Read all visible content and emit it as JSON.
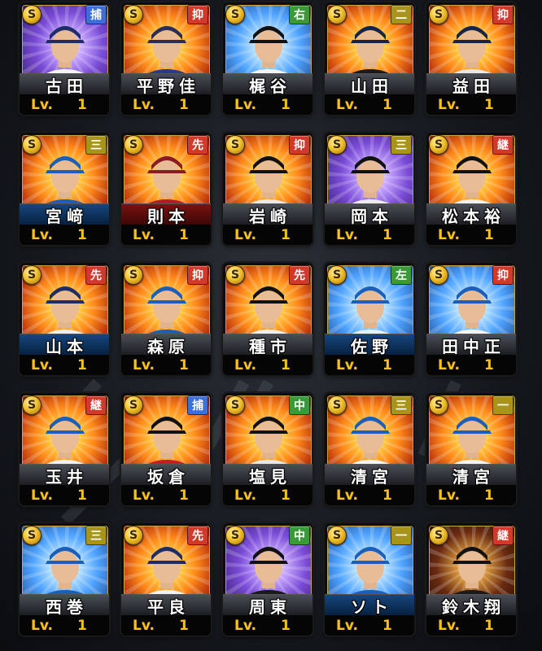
{
  "colors": {
    "catcher": "#2f6fd6",
    "pitcher_relief": "#d23a2a",
    "pitcher_start": "#d23a2a",
    "pitcher_setup": "#d23a2a",
    "infield": "#a9931b",
    "outfield": "#2f8a3a",
    "level_text": "#f6c21a"
  },
  "level_label": "Lv.",
  "rarity_symbol": "S",
  "cards": [
    {
      "name": "古田",
      "position": "捕",
      "pos_color": "#3e6ed8",
      "level": "1",
      "bg": "purple",
      "bar": "gray"
    },
    {
      "name": "平野佳",
      "position": "抑",
      "pos_color": "#cf3a2a",
      "level": "1",
      "bg": "warm",
      "bar": "gray"
    },
    {
      "name": "梶谷",
      "position": "右",
      "pos_color": "#3a9a3a",
      "level": "1",
      "bg": "cool",
      "bar": "gray"
    },
    {
      "name": "山田",
      "position": "二",
      "pos_color": "#a8931b",
      "level": "1",
      "bg": "warm",
      "bar": "gray"
    },
    {
      "name": "益田",
      "position": "抑",
      "pos_color": "#cf3a2a",
      "level": "1",
      "bg": "warm",
      "bar": "gray"
    },
    {
      "name": "宮﨑",
      "position": "三",
      "pos_color": "#a8931b",
      "level": "1",
      "bg": "warm",
      "bar": "blue"
    },
    {
      "name": "則本",
      "position": "先",
      "pos_color": "#cf3a2a",
      "level": "1",
      "bg": "warm",
      "bar": "red"
    },
    {
      "name": "岩崎",
      "position": "抑",
      "pos_color": "#cf3a2a",
      "level": "1",
      "bg": "warm",
      "bar": "gray"
    },
    {
      "name": "岡本",
      "position": "三",
      "pos_color": "#a8931b",
      "level": "1",
      "bg": "purple",
      "bar": "gray"
    },
    {
      "name": "松本裕",
      "position": "継",
      "pos_color": "#cf3a2a",
      "level": "1",
      "bg": "warm",
      "bar": "gray"
    },
    {
      "name": "山本",
      "position": "先",
      "pos_color": "#cf3a2a",
      "level": "1",
      "bg": "warm",
      "bar": "blue"
    },
    {
      "name": "森原",
      "position": "抑",
      "pos_color": "#cf3a2a",
      "level": "1",
      "bg": "warm",
      "bar": "gray"
    },
    {
      "name": "種市",
      "position": "先",
      "pos_color": "#cf3a2a",
      "level": "1",
      "bg": "warm",
      "bar": "gray"
    },
    {
      "name": "佐野",
      "position": "左",
      "pos_color": "#3a9a3a",
      "level": "1",
      "bg": "cool",
      "bar": "blue"
    },
    {
      "name": "田中正",
      "position": "抑",
      "pos_color": "#cf3a2a",
      "level": "1",
      "bg": "cool",
      "bar": "gray"
    },
    {
      "name": "玉井",
      "position": "継",
      "pos_color": "#cf3a2a",
      "level": "1",
      "bg": "warm",
      "bar": "gray"
    },
    {
      "name": "坂倉",
      "position": "捕",
      "pos_color": "#3e6ed8",
      "level": "1",
      "bg": "warm",
      "bar": "gray"
    },
    {
      "name": "塩見",
      "position": "中",
      "pos_color": "#3a9a3a",
      "level": "1",
      "bg": "warm",
      "bar": "gray"
    },
    {
      "name": "清宮",
      "position": "三",
      "pos_color": "#a8931b",
      "level": "1",
      "bg": "warm",
      "bar": "gray"
    },
    {
      "name": "清宮",
      "position": "一",
      "pos_color": "#a8931b",
      "level": "1",
      "bg": "warm",
      "bar": "gray"
    },
    {
      "name": "西巻",
      "position": "三",
      "pos_color": "#a8931b",
      "level": "1",
      "bg": "cool",
      "bar": "gray"
    },
    {
      "name": "平良",
      "position": "先",
      "pos_color": "#cf3a2a",
      "level": "1",
      "bg": "warm",
      "bar": "gray"
    },
    {
      "name": "周東",
      "position": "中",
      "pos_color": "#3a9a3a",
      "level": "1",
      "bg": "purple",
      "bar": "gray"
    },
    {
      "name": "ソト",
      "position": "一",
      "pos_color": "#a8931b",
      "level": "1",
      "bg": "cool",
      "bar": "blue"
    },
    {
      "name": "鈴木翔",
      "position": "継",
      "pos_color": "#cf3a2a",
      "level": "1",
      "bg": "dark",
      "bar": "gray"
    }
  ]
}
